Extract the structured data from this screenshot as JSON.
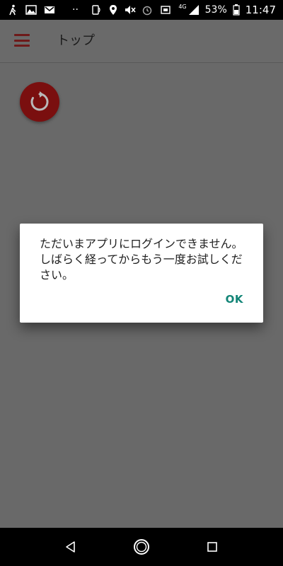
{
  "status_bar": {
    "battery_percent": "53%",
    "time": "11:47",
    "network_type": "4G",
    "icons_left": [
      "walk-icon",
      "image-icon",
      "gmail-icon",
      "dots-icon"
    ],
    "icons_right": [
      "nfc-icon",
      "location-icon",
      "mute-icon",
      "alarm-icon",
      "vibrate-icon",
      "signal-icon",
      "battery-icon"
    ]
  },
  "app_bar": {
    "title": "トップ",
    "menu_icon": "hamburger-menu-icon"
  },
  "refresh_button": {
    "icon": "refresh-icon",
    "color": "#7a0f0f"
  },
  "dialog": {
    "message": "ただいまアプリにログインできません。しばらく経ってからもう一度お試しください。",
    "ok_label": "OK",
    "ok_color": "#138577"
  },
  "nav_bar": {
    "buttons": [
      "back-icon",
      "home-icon",
      "recents-icon"
    ]
  }
}
